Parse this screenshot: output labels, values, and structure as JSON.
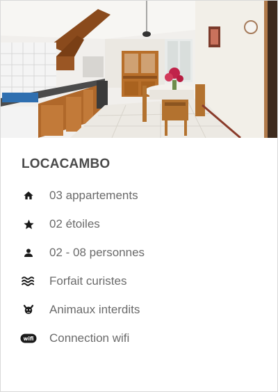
{
  "listing": {
    "photo_alt": "kitchen-dining-room-photo",
    "title": "LOCACAMBO",
    "features": [
      {
        "icon": "home-icon",
        "label": "03 appartements"
      },
      {
        "icon": "star-icon",
        "label": "02 étoiles"
      },
      {
        "icon": "person-icon",
        "label": "02 - 08 personnes"
      },
      {
        "icon": "waves-icon",
        "label": "Forfait curistes"
      },
      {
        "icon": "no-pets-icon",
        "label": "Animaux interdits"
      },
      {
        "icon": "wifi-icon",
        "label": "Connection wifi"
      }
    ]
  },
  "colors": {
    "title": "#4a4a4a",
    "text": "#6a6a6a",
    "icon": "#1a1a1a"
  }
}
